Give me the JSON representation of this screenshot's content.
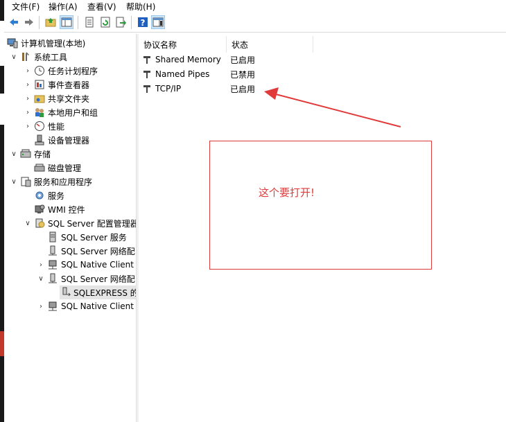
{
  "menu": [
    "文件(F)",
    "操作(A)",
    "查看(V)",
    "帮助(H)"
  ],
  "toolbar": {
    "buttons": [
      "back-icon",
      "forward-icon",
      "folder-up-icon",
      "show-hide-tree-icon",
      "properties-icon",
      "refresh-icon",
      "export-icon",
      "help-icon",
      "action-pane-icon"
    ]
  },
  "tree": {
    "root": "计算机管理(本地)",
    "system_tools": "系统工具",
    "task_scheduler": "任务计划程序",
    "event_viewer": "事件查看器",
    "shared_folders": "共享文件夹",
    "local_users": "本地用户和组",
    "performance": "性能",
    "device_manager": "设备管理器",
    "storage": "存储",
    "disk_management": "磁盘管理",
    "services_apps": "服务和应用程序",
    "services": "服务",
    "wmi": "WMI 控件",
    "sql_config": "SQL Server 配置管理器",
    "sql_services": "SQL Server 服务",
    "sql_network1": "SQL Server 网络配",
    "native_client1": "SQL Native Client",
    "sql_network2": "SQL Server 网络配",
    "sqlexpress": "SQLEXPRESS 的",
    "native_client2": "SQL Native Client"
  },
  "list": {
    "headers": {
      "name": "协议名称",
      "state": "状态"
    },
    "rows": [
      {
        "name": "Shared Memory",
        "state": "已启用"
      },
      {
        "name": "Named Pipes",
        "state": "已禁用"
      },
      {
        "name": "TCP/IP",
        "state": "已启用"
      }
    ]
  },
  "annotation": {
    "text": "这个要打开!",
    "color": "#e03a3a"
  }
}
